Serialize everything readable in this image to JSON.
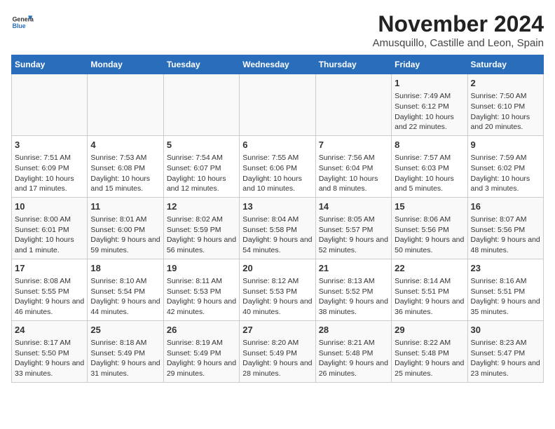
{
  "header": {
    "logo_line1": "General",
    "logo_line2": "Blue",
    "title": "November 2024",
    "subtitle": "Amusquillo, Castille and Leon, Spain"
  },
  "weekdays": [
    "Sunday",
    "Monday",
    "Tuesday",
    "Wednesday",
    "Thursday",
    "Friday",
    "Saturday"
  ],
  "weeks": [
    [
      {
        "day": "",
        "info": ""
      },
      {
        "day": "",
        "info": ""
      },
      {
        "day": "",
        "info": ""
      },
      {
        "day": "",
        "info": ""
      },
      {
        "day": "",
        "info": ""
      },
      {
        "day": "1",
        "info": "Sunrise: 7:49 AM\nSunset: 6:12 PM\nDaylight: 10 hours and 22 minutes."
      },
      {
        "day": "2",
        "info": "Sunrise: 7:50 AM\nSunset: 6:10 PM\nDaylight: 10 hours and 20 minutes."
      }
    ],
    [
      {
        "day": "3",
        "info": "Sunrise: 7:51 AM\nSunset: 6:09 PM\nDaylight: 10 hours and 17 minutes."
      },
      {
        "day": "4",
        "info": "Sunrise: 7:53 AM\nSunset: 6:08 PM\nDaylight: 10 hours and 15 minutes."
      },
      {
        "day": "5",
        "info": "Sunrise: 7:54 AM\nSunset: 6:07 PM\nDaylight: 10 hours and 12 minutes."
      },
      {
        "day": "6",
        "info": "Sunrise: 7:55 AM\nSunset: 6:06 PM\nDaylight: 10 hours and 10 minutes."
      },
      {
        "day": "7",
        "info": "Sunrise: 7:56 AM\nSunset: 6:04 PM\nDaylight: 10 hours and 8 minutes."
      },
      {
        "day": "8",
        "info": "Sunrise: 7:57 AM\nSunset: 6:03 PM\nDaylight: 10 hours and 5 minutes."
      },
      {
        "day": "9",
        "info": "Sunrise: 7:59 AM\nSunset: 6:02 PM\nDaylight: 10 hours and 3 minutes."
      }
    ],
    [
      {
        "day": "10",
        "info": "Sunrise: 8:00 AM\nSunset: 6:01 PM\nDaylight: 10 hours and 1 minute."
      },
      {
        "day": "11",
        "info": "Sunrise: 8:01 AM\nSunset: 6:00 PM\nDaylight: 9 hours and 59 minutes."
      },
      {
        "day": "12",
        "info": "Sunrise: 8:02 AM\nSunset: 5:59 PM\nDaylight: 9 hours and 56 minutes."
      },
      {
        "day": "13",
        "info": "Sunrise: 8:04 AM\nSunset: 5:58 PM\nDaylight: 9 hours and 54 minutes."
      },
      {
        "day": "14",
        "info": "Sunrise: 8:05 AM\nSunset: 5:57 PM\nDaylight: 9 hours and 52 minutes."
      },
      {
        "day": "15",
        "info": "Sunrise: 8:06 AM\nSunset: 5:56 PM\nDaylight: 9 hours and 50 minutes."
      },
      {
        "day": "16",
        "info": "Sunrise: 8:07 AM\nSunset: 5:56 PM\nDaylight: 9 hours and 48 minutes."
      }
    ],
    [
      {
        "day": "17",
        "info": "Sunrise: 8:08 AM\nSunset: 5:55 PM\nDaylight: 9 hours and 46 minutes."
      },
      {
        "day": "18",
        "info": "Sunrise: 8:10 AM\nSunset: 5:54 PM\nDaylight: 9 hours and 44 minutes."
      },
      {
        "day": "19",
        "info": "Sunrise: 8:11 AM\nSunset: 5:53 PM\nDaylight: 9 hours and 42 minutes."
      },
      {
        "day": "20",
        "info": "Sunrise: 8:12 AM\nSunset: 5:53 PM\nDaylight: 9 hours and 40 minutes."
      },
      {
        "day": "21",
        "info": "Sunrise: 8:13 AM\nSunset: 5:52 PM\nDaylight: 9 hours and 38 minutes."
      },
      {
        "day": "22",
        "info": "Sunrise: 8:14 AM\nSunset: 5:51 PM\nDaylight: 9 hours and 36 minutes."
      },
      {
        "day": "23",
        "info": "Sunrise: 8:16 AM\nSunset: 5:51 PM\nDaylight: 9 hours and 35 minutes."
      }
    ],
    [
      {
        "day": "24",
        "info": "Sunrise: 8:17 AM\nSunset: 5:50 PM\nDaylight: 9 hours and 33 minutes."
      },
      {
        "day": "25",
        "info": "Sunrise: 8:18 AM\nSunset: 5:49 PM\nDaylight: 9 hours and 31 minutes."
      },
      {
        "day": "26",
        "info": "Sunrise: 8:19 AM\nSunset: 5:49 PM\nDaylight: 9 hours and 29 minutes."
      },
      {
        "day": "27",
        "info": "Sunrise: 8:20 AM\nSunset: 5:49 PM\nDaylight: 9 hours and 28 minutes."
      },
      {
        "day": "28",
        "info": "Sunrise: 8:21 AM\nSunset: 5:48 PM\nDaylight: 9 hours and 26 minutes."
      },
      {
        "day": "29",
        "info": "Sunrise: 8:22 AM\nSunset: 5:48 PM\nDaylight: 9 hours and 25 minutes."
      },
      {
        "day": "30",
        "info": "Sunrise: 8:23 AM\nSunset: 5:47 PM\nDaylight: 9 hours and 23 minutes."
      }
    ]
  ]
}
